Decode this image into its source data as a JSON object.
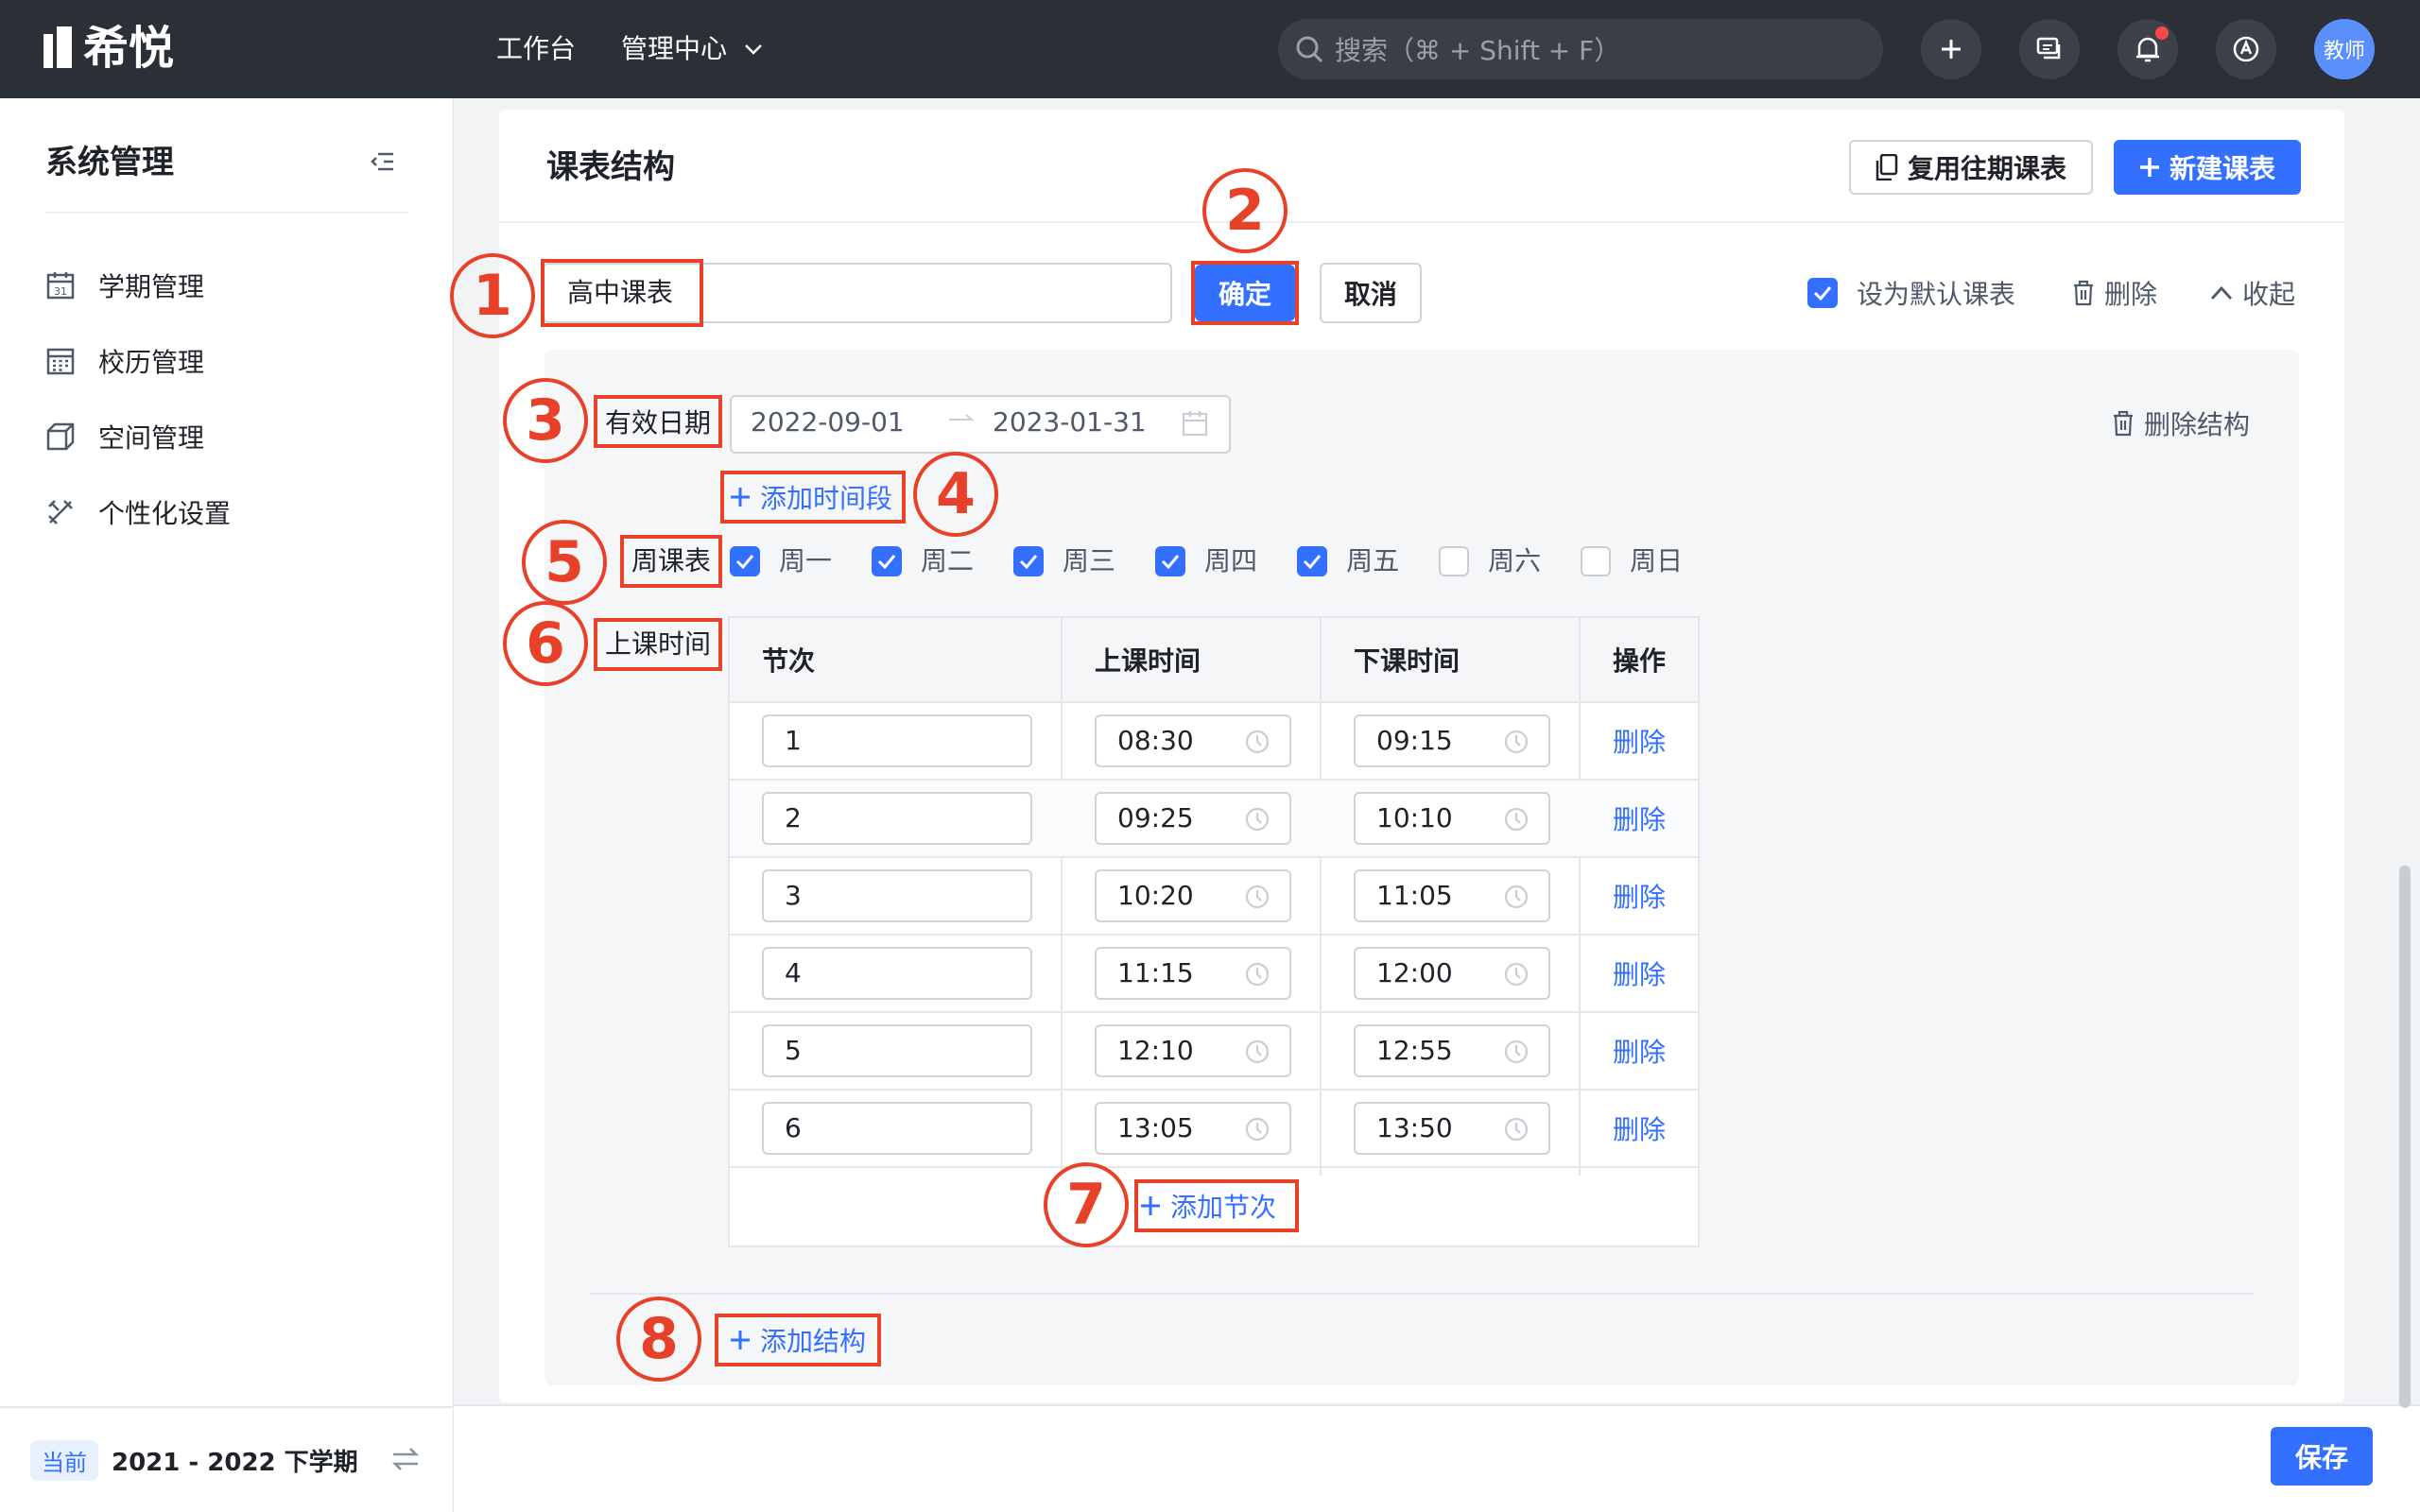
{
  "app": {
    "logo_text": "希悦",
    "avatar_text": "教师"
  },
  "topnav": {
    "workbench": "工作台",
    "manage_center": "管理中心",
    "search_placeholder": "搜索（⌘ + Shift + F）"
  },
  "sidebar": {
    "title": "系统管理",
    "items": [
      {
        "label": "学期管理",
        "icon": "calendar-icon"
      },
      {
        "label": "校历管理",
        "icon": "school-calendar-icon"
      },
      {
        "label": "空间管理",
        "icon": "cube-icon"
      },
      {
        "label": "个性化设置",
        "icon": "tools-icon"
      }
    ],
    "term_tag": "当前",
    "term_text": "2021 - 2022 下学期"
  },
  "page": {
    "title": "课表结构",
    "reuse_button": "复用往期课表",
    "new_button": "新建课表",
    "schedule_name": "高中课表",
    "confirm_button": "确定",
    "cancel_button": "取消",
    "default_label": "设为默认课表",
    "delete_label": "删除",
    "collapse_label": "收起",
    "save_button": "保存"
  },
  "structure": {
    "date_label": "有效日期",
    "date_start": "2022-09-01",
    "date_end": "2023-01-31",
    "delete_structure": "删除结构",
    "add_period": "添加时间段",
    "week_label": "周课表",
    "days": [
      {
        "label": "周一",
        "checked": true
      },
      {
        "label": "周二",
        "checked": true
      },
      {
        "label": "周三",
        "checked": true
      },
      {
        "label": "周四",
        "checked": true
      },
      {
        "label": "周五",
        "checked": true
      },
      {
        "label": "周六",
        "checked": false
      },
      {
        "label": "周日",
        "checked": false
      }
    ],
    "time_label": "上课时间",
    "columns": [
      "节次",
      "上课时间",
      "下课时间",
      "操作"
    ],
    "rows": [
      {
        "period": "1",
        "start": "08:30",
        "end": "09:15",
        "action": "删除"
      },
      {
        "period": "2",
        "start": "09:25",
        "end": "10:10",
        "action": "删除"
      },
      {
        "period": "3",
        "start": "10:20",
        "end": "11:05",
        "action": "删除"
      },
      {
        "period": "4",
        "start": "11:15",
        "end": "12:00",
        "action": "删除"
      },
      {
        "period": "5",
        "start": "12:10",
        "end": "12:55",
        "action": "删除"
      },
      {
        "period": "6",
        "start": "13:05",
        "end": "13:50",
        "action": "删除"
      }
    ],
    "add_lesson": "添加节次",
    "add_structure": "添加结构"
  },
  "annotations": [
    "1",
    "2",
    "3",
    "4",
    "5",
    "6",
    "7",
    "8"
  ],
  "colors": {
    "accent": "#3370ff",
    "annotation": "#e8412a",
    "topbar": "#2b2f36"
  }
}
